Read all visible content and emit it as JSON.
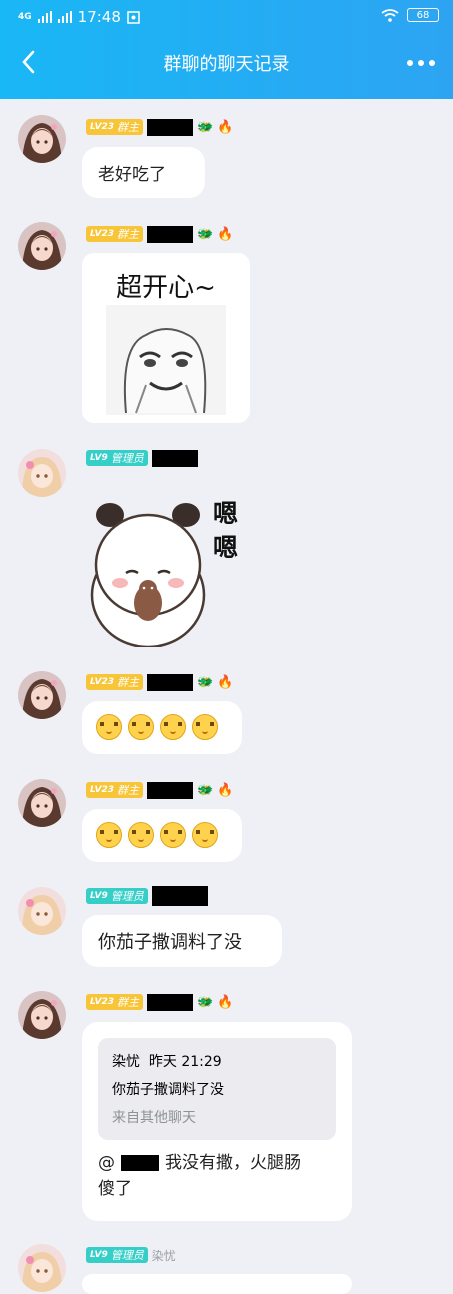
{
  "status": {
    "time": "17:48",
    "network": "4G",
    "battery": "68"
  },
  "header": {
    "title": "群聊的聊天记录"
  },
  "messages": [
    {
      "level": "LV23",
      "role": "群主",
      "text": "老好吃了",
      "type": "text"
    },
    {
      "level": "LV23",
      "role": "群主",
      "sticker_text": "超开心~",
      "type": "sticker"
    },
    {
      "level": "LV9",
      "role": "管理员",
      "sticker_text": "嗯嗯",
      "type": "sticker"
    },
    {
      "level": "LV23",
      "role": "群主",
      "type": "emoji",
      "count": 4
    },
    {
      "level": "LV23",
      "role": "群主",
      "type": "emoji",
      "count": 4
    },
    {
      "level": "LV9",
      "role": "管理员",
      "text": "你茄子撒调料了没",
      "type": "text"
    },
    {
      "level": "LV23",
      "role": "群主",
      "type": "reply",
      "quote": {
        "author": "染忧",
        "time": "昨天 21:29",
        "text": "你茄子撒调料了没",
        "source": "来自其他聊天"
      },
      "mention": "@",
      "text_line1": "我没有撒，火腿肠",
      "text_line2": "傻了"
    },
    {
      "level": "LV9",
      "role": "管理员",
      "name": "染忧",
      "type": "partial"
    }
  ]
}
